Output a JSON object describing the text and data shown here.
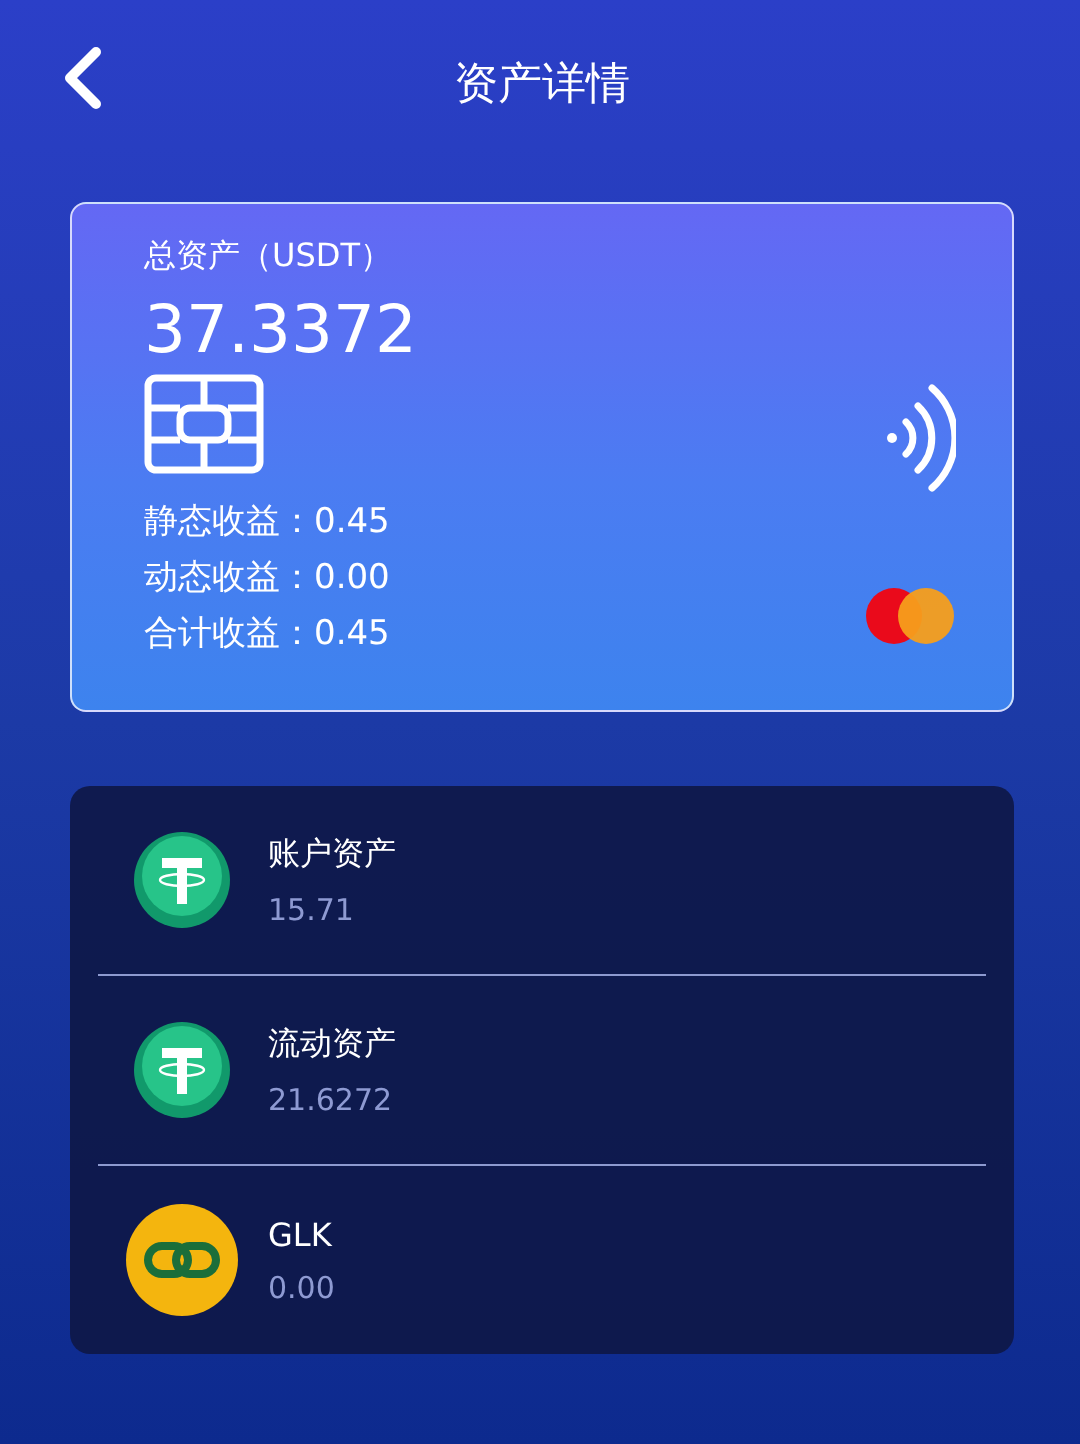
{
  "header": {
    "title": "资产详情"
  },
  "card": {
    "label": "总资产（USDT）",
    "total": "37.3372",
    "earnings": [
      "静态收益：0.45",
      "动态收益：0.00",
      "合计收益：0.45"
    ]
  },
  "assets": [
    {
      "kind": "tether",
      "name": "账户资产",
      "value": "15.71"
    },
    {
      "kind": "tether",
      "name": "流动资产",
      "value": "21.6272"
    },
    {
      "kind": "chain",
      "name": "GLK",
      "value": "0.00"
    }
  ]
}
